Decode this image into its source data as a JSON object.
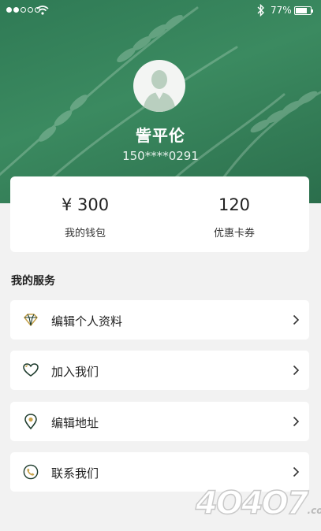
{
  "status_bar": {
    "battery_percent_text": "77%",
    "battery_level": 0.77
  },
  "profile": {
    "name": "訾平伦",
    "phone": "150****0291"
  },
  "wallet": {
    "balance_value": "¥ 300",
    "balance_label": "我的钱包",
    "coupon_value": "120",
    "coupon_label": "优惠卡券"
  },
  "services": {
    "title": "我的服务",
    "items": [
      {
        "label": "编辑个人资料",
        "icon": "diamond-icon"
      },
      {
        "label": "加入我们",
        "icon": "heart-icon"
      },
      {
        "label": "编辑地址",
        "icon": "location-pin-icon"
      },
      {
        "label": "联系我们",
        "icon": "phone-icon"
      }
    ]
  },
  "watermark": {
    "text": "4O4O7",
    "suffix": ".com"
  },
  "colors": {
    "brand_green": "#2f7a55",
    "icon_gold": "#c8a34a",
    "icon_dark": "#1d3b2c"
  }
}
